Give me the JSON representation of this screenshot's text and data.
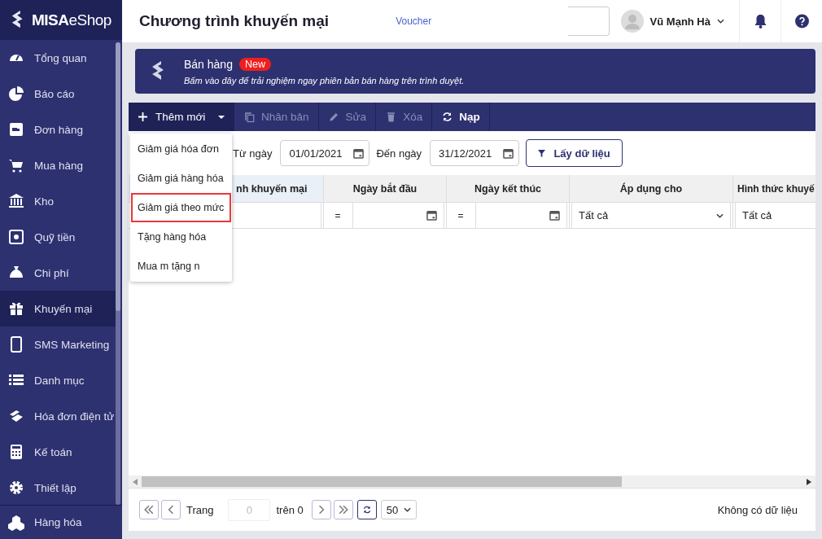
{
  "brand": {
    "logo": "**MISA**eShop"
  },
  "sidebar": {
    "items": [
      {
        "label": "Tổng quan",
        "selected": false
      },
      {
        "label": "Báo cáo",
        "selected": false
      },
      {
        "label": "Đơn hàng",
        "selected": false
      },
      {
        "label": "Mua hàng",
        "selected": false
      },
      {
        "label": "Kho",
        "selected": false
      },
      {
        "label": "Quỹ tiền",
        "selected": false
      },
      {
        "label": "Chi phí",
        "selected": false
      },
      {
        "label": "Khuyến mại",
        "selected": true
      },
      {
        "label": "SMS Marketing",
        "selected": false
      },
      {
        "label": "Danh mục",
        "selected": false
      },
      {
        "label": "Hóa đơn điện tử",
        "selected": false
      },
      {
        "label": "Kế toán",
        "selected": false
      },
      {
        "label": "Thiết lập",
        "selected": false
      }
    ],
    "footer_item": {
      "label": "Hàng hóa",
      "selected": false
    }
  },
  "header": {
    "title": "Chương trình khuyến mại",
    "link": "Voucher",
    "user": "Vũ Mạnh Hà"
  },
  "banner": {
    "title": "Bán hàng",
    "badge": "New",
    "text": "Bấm vào đây để trải nghiệm ngay phiên bản bán hàng trên trình duyệt."
  },
  "toolbar": {
    "add": "Thêm mới",
    "buttons": [
      {
        "label": "Nhân bản",
        "disabled": true
      },
      {
        "label": "Sửa",
        "disabled": true
      },
      {
        "label": "Xóa",
        "disabled": true
      },
      {
        "label": "Nạp",
        "disabled": false
      }
    ]
  },
  "add_menu": {
    "items": [
      {
        "label": "Giảm giá hóa đơn",
        "selected": false
      },
      {
        "label": "Giảm giá hàng hóa",
        "selected": false
      },
      {
        "label": "Giảm giá theo mức",
        "selected": true
      },
      {
        "label": "Tặng hàng hóa",
        "selected": false
      },
      {
        "label": "Mua m tặng n",
        "selected": false
      }
    ]
  },
  "filter": {
    "from_label": "Từ ngày",
    "from": "01/01/2021",
    "to_label": "Đến ngày",
    "to": "31/12/2021",
    "button": "Lấy dữ liệu"
  },
  "table": {
    "columns": [
      {
        "label": "nh khuyến mại",
        "kind": "text"
      },
      {
        "label": "Ngày bắt đầu",
        "kind": "date",
        "operator": "="
      },
      {
        "label": "Ngày kết thúc",
        "kind": "date",
        "operator": "="
      },
      {
        "label": "Áp dụng cho",
        "kind": "select",
        "value": "Tất cả"
      },
      {
        "label": "Hình thức khuyế",
        "kind": "select",
        "value": "Tất cả"
      }
    ]
  },
  "pager": {
    "page_label": "Trang",
    "page": "0",
    "of": "trên 0",
    "page_size": "50",
    "status": "Không có dữ liệu"
  }
}
